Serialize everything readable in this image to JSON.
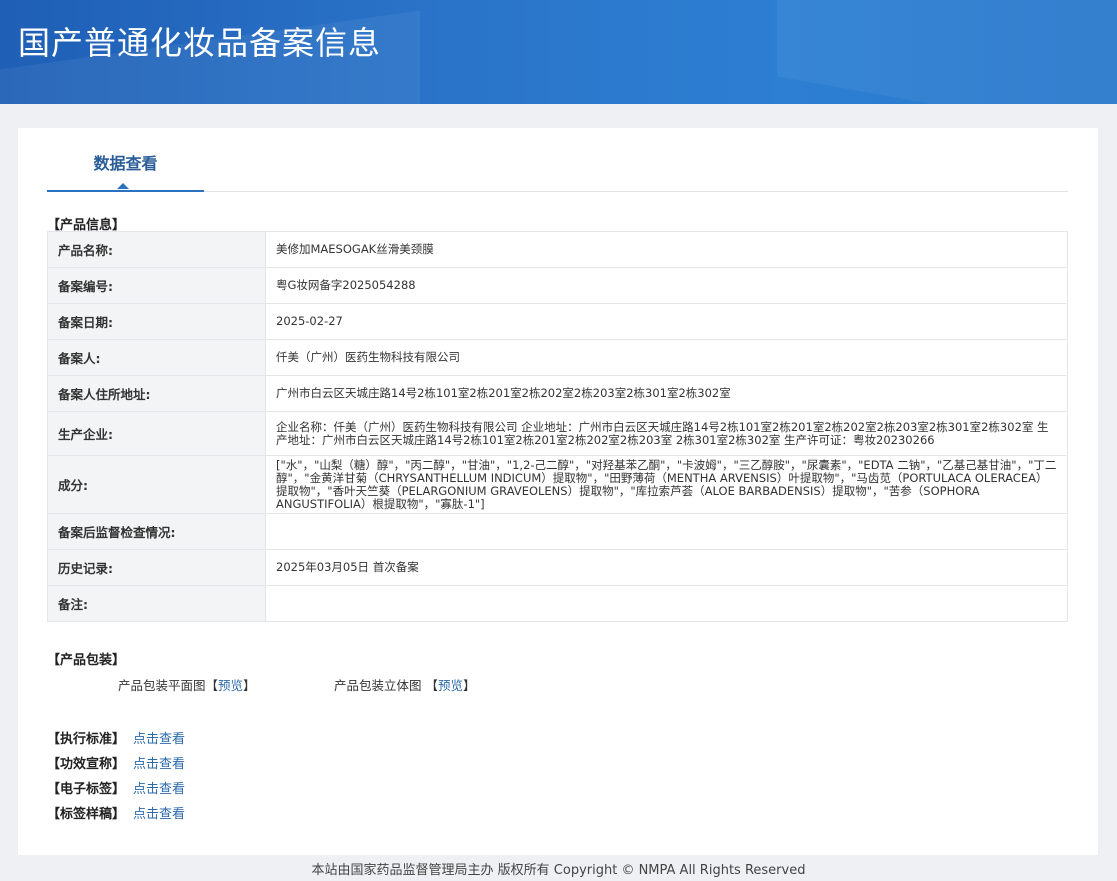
{
  "header": {
    "title": "国产普通化妆品备案信息"
  },
  "tabs": [
    {
      "label": "数据查看"
    }
  ],
  "product_info": {
    "section_title": "【产品信息】",
    "rows": [
      {
        "label": "产品名称:",
        "value": "美修加MAESOGAK丝滑美颈膜"
      },
      {
        "label": "备案编号:",
        "value": "粤G妆网备字2025054288"
      },
      {
        "label": "备案日期:",
        "value": "2025-02-27"
      },
      {
        "label": "备案人:",
        "value": "仟美（广州）医药生物科技有限公司"
      },
      {
        "label": "备案人住所地址:",
        "value": "广州市白云区天城庄路14号2栋101室2栋201室2栋202室2栋203室2栋301室2栋302室"
      },
      {
        "label": "生产企业:",
        "value": "企业名称：仟美（广州）医药生物科技有限公司 企业地址：广州市白云区天城庄路14号2栋101室2栋201室2栋202室2栋203室2栋301室2栋302室 生产地址：广州市白云区天城庄路14号2栋101室2栋201室2栋202室2栋203室 2栋301室2栋302室 生产许可证：粤妆20230266"
      },
      {
        "label": "成分:",
        "value": "[\"水\"，\"山梨（糖）醇\"，\"丙二醇\"，\"甘油\"，\"1,2-己二醇\"，\"对羟基苯乙酮\"，\"卡波姆\"，\"三乙醇胺\"，\"尿囊素\"，\"EDTA 二钠\"，\"乙基己基甘油\"，\"丁二醇\"，\"金黄洋甘菊（CHRYSANTHELLUM INDICUM）提取物\"，\"田野薄荷（MENTHA ARVENSIS）叶提取物\"，\"马齿苋（PORTULACA OLERACEA）提取物\"，\"香叶天竺葵（PELARGONIUM GRAVEOLENS）提取物\"，\"库拉索芦荟（ALOE BARBADENSIS）提取物\"，\"苦参（SOPHORA ANGUSTIFOLIA）根提取物\"，\"寡肽-1\"]"
      },
      {
        "label": "备案后监督检查情况:",
        "value": ""
      },
      {
        "label": "历史记录:",
        "value": "2025年03月05日 首次备案"
      },
      {
        "label": "备注:",
        "value": ""
      }
    ]
  },
  "packaging": {
    "section_title": "【产品包装】",
    "flat_label": "产品包装平面图",
    "flat_link": "预览",
    "solid_label": "产品包装立体图",
    "solid_link": "预览"
  },
  "links": [
    {
      "label": "【执行标准】",
      "link": "点击查看"
    },
    {
      "label": "【功效宣称】",
      "link": "点击查看"
    },
    {
      "label": "【电子标签】",
      "link": "点击查看"
    },
    {
      "label": "【标签样稿】",
      "link": "点击查看"
    }
  ],
  "footer": {
    "text": "本站由国家药品监督管理局主办 版权所有 Copyright © NMPA All Rights Reserved"
  }
}
